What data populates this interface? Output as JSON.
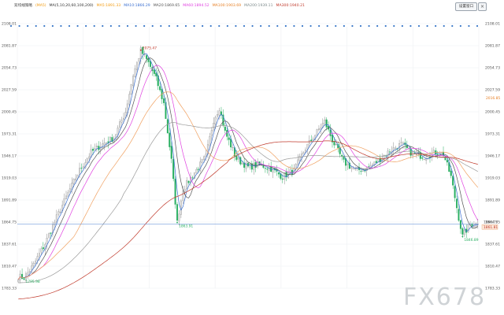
{
  "toolbar": {
    "legend": [
      {
        "text": "双均线策略",
        "color": "#333333"
      },
      {
        "text": "(MA5)",
        "color": "#f39c12"
      },
      {
        "text": "MA(5,10,20,60,100,200)",
        "color": "#333333"
      },
      {
        "text": "MA5:1891.33",
        "color": "#f39c12"
      },
      {
        "text": "MA10:1866.29",
        "color": "#3a6fd0"
      },
      {
        "text": "MA20:1869.65",
        "color": "#555555"
      },
      {
        "text": "MA60:1894.52",
        "color": "#e040e0"
      },
      {
        "text": "MA100:1903.69",
        "color": "#e67e22"
      },
      {
        "text": "MA200:1939.11",
        "color": "#7f8c8d"
      },
      {
        "text": "MA300:1940.21",
        "color": "#c0392b"
      }
    ],
    "config_label": "设置窗口",
    "close_label": "×"
  },
  "watermark": "FX678",
  "chart_data": {
    "type": "candlestick",
    "title": "",
    "y_axis_left_labels": [
      "2108.01",
      "2081.87",
      "2054.73",
      "2027.59",
      "2000.45",
      "1973.31",
      "1946.17",
      "1919.03",
      "1891.89",
      "1864.75",
      "1837.61",
      "1810.47",
      "1783.33"
    ],
    "y_axis_right_labels": [
      "2108.01",
      "2081.87",
      "2054.73",
      "2027.59",
      "2000.45",
      "1973.31",
      "1946.17",
      "1919.03",
      "1891.89",
      "1864.75",
      "1837.61",
      "1810.47",
      "1783.33"
    ],
    "ylim": [
      1783.33,
      2108.01
    ],
    "grid": true,
    "x_tick_labels": [],
    "current_price": 1861.81,
    "current_price_label": "1861.81",
    "current_price_label_upper": "1864.75",
    "marker_price_label": "2016.85",
    "marker_price": 2016.85,
    "signal_count": 57,
    "annotations": [
      {
        "text": "2075.47",
        "index": 64,
        "value": 2075.47,
        "color": "#c0392b"
      },
      {
        "text": "1863.91",
        "index": 83,
        "value": 1863.91,
        "color": "#27ae60"
      },
      {
        "text": "1795.98",
        "index": 3,
        "value": 1795.98,
        "color": "#27ae60"
      },
      {
        "text": "1846.89",
        "index": 232,
        "value": 1846.89,
        "color": "#27ae60"
      }
    ],
    "keypoints": [
      [
        0,
        1798
      ],
      [
        3,
        1796
      ],
      [
        8,
        1812
      ],
      [
        14,
        1838
      ],
      [
        20,
        1870
      ],
      [
        26,
        1900
      ],
      [
        32,
        1928
      ],
      [
        38,
        1950
      ],
      [
        44,
        1960
      ],
      [
        50,
        1968
      ],
      [
        56,
        2000
      ],
      [
        60,
        2045
      ],
      [
        64,
        2075
      ],
      [
        68,
        2060
      ],
      [
        72,
        2040
      ],
      [
        76,
        2010
      ],
      [
        80,
        1940
      ],
      [
        83,
        1864
      ],
      [
        86,
        1905
      ],
      [
        92,
        1925
      ],
      [
        98,
        1945
      ],
      [
        102,
        1990
      ],
      [
        105,
        2005
      ],
      [
        108,
        1975
      ],
      [
        114,
        1942
      ],
      [
        120,
        1932
      ],
      [
        126,
        1935
      ],
      [
        132,
        1930
      ],
      [
        138,
        1920
      ],
      [
        144,
        1928
      ],
      [
        150,
        1955
      ],
      [
        156,
        1975
      ],
      [
        160,
        1988
      ],
      [
        164,
        1965
      ],
      [
        170,
        1938
      ],
      [
        176,
        1928
      ],
      [
        182,
        1930
      ],
      [
        188,
        1940
      ],
      [
        194,
        1952
      ],
      [
        200,
        1960
      ],
      [
        206,
        1948
      ],
      [
        212,
        1945
      ],
      [
        218,
        1950
      ],
      [
        222,
        1948
      ],
      [
        226,
        1920
      ],
      [
        230,
        1870
      ],
      [
        232,
        1847
      ],
      [
        236,
        1862
      ],
      [
        240,
        1862
      ]
    ],
    "series": [
      {
        "name": "MA5",
        "color": "#3a6fd0"
      },
      {
        "name": "MA10",
        "color": "#555555"
      },
      {
        "name": "MA20",
        "color": "#e040e0"
      },
      {
        "name": "MA60",
        "color": "#f0a060"
      },
      {
        "name": "MA100",
        "color": "#9a9a9a"
      },
      {
        "name": "MA200",
        "color": "#c0392b"
      }
    ],
    "colors": {
      "up": "#e0e0e0",
      "up_border": "#8a8a8a",
      "down": "#27ae60",
      "current_line": "#4a7fd0",
      "signal_dot": "#3a78c8",
      "grid": "#eef0f2",
      "axis_text": "#555555"
    }
  }
}
